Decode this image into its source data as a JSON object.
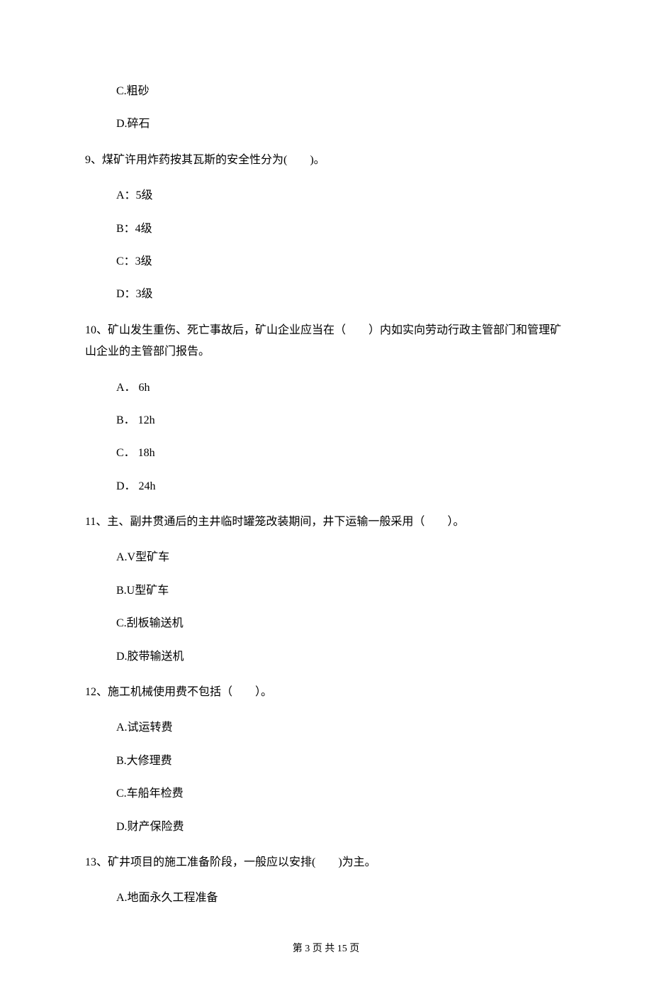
{
  "q8": {
    "optC": "C.粗砂",
    "optD": "D.碎石"
  },
  "q9": {
    "text": "9、煤矿许用炸药按其瓦斯的安全性分为(　　)。",
    "optA": "A：5级",
    "optB": "B：4级",
    "optC": "C：3级",
    "optD": "D：3级"
  },
  "q10": {
    "text": "10、矿山发生重伤、死亡事故后，矿山企业应当在（　　）内如实向劳动行政主管部门和管理矿山企业的主管部门报告。",
    "optA": "A． 6h",
    "optB": "B． 12h",
    "optC": "C． 18h",
    "optD": "D． 24h"
  },
  "q11": {
    "text": "11、主、副井贯通后的主井临时罐笼改装期间，井下运输一般采用（　　）。",
    "optA": "A.V型矿车",
    "optB": "B.U型矿车",
    "optC": "C.刮板输送机",
    "optD": "D.胶带输送机"
  },
  "q12": {
    "text": "12、施工机械使用费不包括（　　）。",
    "optA": "A.试运转费",
    "optB": "B.大修理费",
    "optC": "C.车船年检费",
    "optD": "D.财产保险费"
  },
  "q13": {
    "text": "13、矿井项目的施工准备阶段，一般应以安排(　　)为主。",
    "optA": "A.地面永久工程准备"
  },
  "footer": "第 3 页 共 15 页"
}
